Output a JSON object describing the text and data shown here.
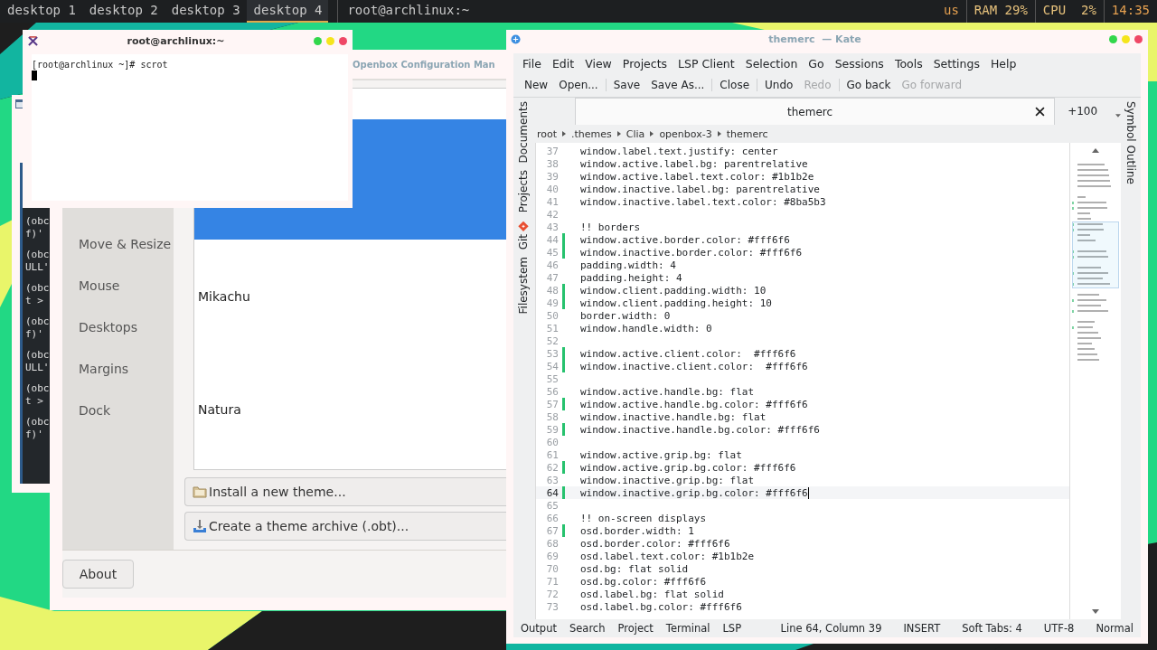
{
  "top_bar": {
    "desktops": [
      {
        "label": "desktop 1",
        "selected": false
      },
      {
        "label": "desktop 2",
        "selected": false
      },
      {
        "label": "desktop 3",
        "selected": false
      },
      {
        "label": "desktop 4",
        "selected": true
      }
    ],
    "window_title": "root@archlinux:~",
    "indicators": [
      "us",
      "RAM 29%",
      "CPU  2%",
      "14:35"
    ]
  },
  "background_terminal": {
    "line_groups": [
      [
        "(obc",
        "f)'"
      ],
      [
        "(obc",
        "ULL'"
      ],
      [
        "(obc",
        "t >"
      ],
      [
        "(obc",
        "f)'"
      ],
      [
        "(obc",
        "ULL'"
      ],
      [
        "(obc",
        "t >"
      ],
      [
        "(obc",
        "f)'"
      ]
    ]
  },
  "obconf": {
    "title": "Openbox Configuration Man",
    "sidebar_items": [
      "Move & Resize",
      "Mouse",
      "Desktops",
      "Margins",
      "Dock"
    ],
    "themes": [
      {
        "selected": true
      },
      {
        "name": "Mikachu",
        "selected": false
      },
      {
        "name": "Natura",
        "selected": false
      }
    ],
    "install_button": "Install a new theme...",
    "archive_button": "Create a theme archive (.obt)...",
    "about_button": "About"
  },
  "terminal": {
    "title": "root@archlinux:~",
    "prompt": "[root@archlinux ~]# scrot"
  },
  "kate": {
    "title": "themerc  — Kate",
    "menu": [
      "File",
      "Edit",
      "View",
      "Projects",
      "LSP Client",
      "Selection",
      "Go",
      "Sessions",
      "Tools",
      "Settings",
      "Help"
    ],
    "toolbar_groups": [
      {
        "items": [
          {
            "label": "New",
            "disabled": false
          },
          {
            "label": "Open...",
            "disabled": false
          }
        ]
      },
      {
        "items": [
          {
            "label": "Save",
            "disabled": false
          },
          {
            "label": "Save As...",
            "disabled": false
          }
        ]
      },
      {
        "items": [
          {
            "label": "Close",
            "disabled": false
          }
        ]
      },
      {
        "items": [
          {
            "label": "Undo",
            "disabled": false
          },
          {
            "label": "Redo",
            "disabled": true
          }
        ]
      },
      {
        "items": [
          {
            "label": "Go back",
            "disabled": false
          },
          {
            "label": "Go forward",
            "disabled": true
          }
        ]
      }
    ],
    "left_panels": [
      {
        "label": "Documents",
        "kind": "text"
      },
      {
        "label": "Projects",
        "kind": "text"
      },
      {
        "label": "Git",
        "kind": "git"
      },
      {
        "label": "Filesystem",
        "kind": "text"
      }
    ],
    "right_panel": "Symbol Outline",
    "tabs": [
      {
        "label": "themerc",
        "selected": true
      }
    ],
    "more_tabs": "+100",
    "breadcrumb": [
      "root",
      ".themes",
      "Clia",
      "openbox-3",
      "themerc"
    ],
    "code_lines": [
      {
        "number": "37",
        "text": "window.label.text.justify: center",
        "modified": false,
        "current": false
      },
      {
        "number": "38",
        "text": "window.active.label.bg: parentrelative",
        "modified": false,
        "current": false
      },
      {
        "number": "39",
        "text": "window.active.label.text.color: #1b1b2e",
        "modified": false,
        "current": false
      },
      {
        "number": "40",
        "text": "window.inactive.label.bg: parentrelative",
        "modified": false,
        "current": false
      },
      {
        "number": "41",
        "text": "window.inactive.label.text.color: #8ba5b3",
        "modified": false,
        "current": false
      },
      {
        "number": "42",
        "modified": false,
        "current": false
      },
      {
        "number": "43",
        "text": "!! borders",
        "modified": false,
        "current": false
      },
      {
        "number": "44",
        "text": "window.active.border.color: #fff6f6",
        "modified": true,
        "current": false
      },
      {
        "number": "45",
        "text": "window.inactive.border.color: #fff6f6",
        "modified": true,
        "current": false
      },
      {
        "number": "46",
        "text": "padding.width: 4",
        "modified": false,
        "current": false
      },
      {
        "number": "47",
        "text": "padding.height: 4",
        "modified": false,
        "current": false
      },
      {
        "number": "48",
        "text": "window.client.padding.width: 10",
        "modified": true,
        "current": false
      },
      {
        "number": "49",
        "text": "window.client.padding.height: 10",
        "modified": true,
        "current": false
      },
      {
        "number": "50",
        "text": "border.width: 0",
        "modified": false,
        "current": false
      },
      {
        "number": "51",
        "text": "window.handle.width: 0",
        "modified": false,
        "current": false
      },
      {
        "number": "52",
        "modified": false,
        "current": false
      },
      {
        "number": "53",
        "text": "window.active.client.color:  #fff6f6",
        "modified": true,
        "current": false
      },
      {
        "number": "54",
        "text": "window.inactive.client.color:  #fff6f6",
        "modified": true,
        "current": false
      },
      {
        "number": "55",
        "modified": false,
        "current": false
      },
      {
        "number": "56",
        "text": "window.active.handle.bg: flat",
        "modified": false,
        "current": false
      },
      {
        "number": "57",
        "text": "window.active.handle.bg.color: #fff6f6",
        "modified": true,
        "current": false
      },
      {
        "number": "58",
        "text": "window.inactive.handle.bg: flat",
        "modified": false,
        "current": false
      },
      {
        "number": "59",
        "text": "window.inactive.handle.bg.color: #fff6f6",
        "modified": true,
        "current": false
      },
      {
        "number": "60",
        "modified": false,
        "current": false
      },
      {
        "number": "61",
        "text": "window.active.grip.bg: flat",
        "modified": false,
        "current": false
      },
      {
        "number": "62",
        "text": "window.active.grip.bg.color: #fff6f6",
        "modified": true,
        "current": false
      },
      {
        "number": "63",
        "text": "window.inactive.grip.bg: flat",
        "modified": false,
        "current": false
      },
      {
        "number": "64",
        "text": "window.inactive.grip.bg.color: #fff6f6",
        "modified": true,
        "current": true
      },
      {
        "number": "65",
        "modified": false,
        "current": false
      },
      {
        "number": "66",
        "text": "!! on-screen displays",
        "modified": false,
        "current": false
      },
      {
        "number": "67",
        "text": "osd.border.width: 1",
        "modified": true,
        "current": false
      },
      {
        "number": "68",
        "text": "osd.border.color: #fff6f6",
        "modified": false,
        "current": false
      },
      {
        "number": "69",
        "text": "osd.label.text.color: #1b1b2e",
        "modified": false,
        "current": false
      },
      {
        "number": "70",
        "text": "osd.bg: flat solid",
        "modified": false,
        "current": false
      },
      {
        "number": "71",
        "text": "osd.bg.color: #fff6f6",
        "modified": false,
        "current": false
      },
      {
        "number": "72",
        "text": "osd.label.bg: flat solid",
        "modified": false,
        "current": false
      },
      {
        "number": "73",
        "text": "osd.label.bg.color: #fff6f6",
        "modified": false,
        "current": false
      }
    ],
    "status_panels": [
      "Output",
      "Search",
      "Project",
      "Terminal",
      "LSP"
    ],
    "status_info": [
      "Line 64, Column 39",
      "INSERT",
      "Soft Tabs: 4",
      "UTF-8",
      "Normal"
    ]
  }
}
